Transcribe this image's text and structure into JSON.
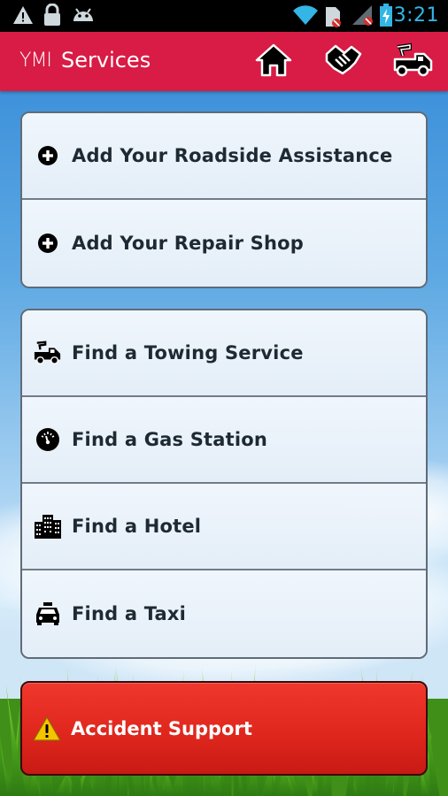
{
  "status_bar": {
    "time": "3:21",
    "icons": [
      "warning-icon",
      "lock-icon",
      "android-icon",
      "wifi-icon",
      "sim-icon",
      "signal-icon",
      "battery-icon"
    ]
  },
  "action_bar": {
    "logo": "YMI",
    "title": "Services",
    "background_color": "#d81c45",
    "buttons": [
      "home-icon",
      "handshake-icon",
      "tow-truck-icon"
    ]
  },
  "add_group": [
    {
      "label": "Add Your Roadside Assistance",
      "icon": "plus-circle-icon"
    },
    {
      "label": "Add Your Repair Shop",
      "icon": "plus-circle-icon"
    }
  ],
  "find_group": [
    {
      "label": "Find a Towing Service",
      "icon": "tow-truck-icon"
    },
    {
      "label": "Find a Gas Station",
      "icon": "fuel-gauge-icon"
    },
    {
      "label": "Find a Hotel",
      "icon": "buildings-icon"
    },
    {
      "label": "Find a Taxi",
      "icon": "taxi-icon"
    }
  ],
  "accident": {
    "label": "Accident Support",
    "icon": "warning-icon",
    "color": "#e0271e"
  }
}
